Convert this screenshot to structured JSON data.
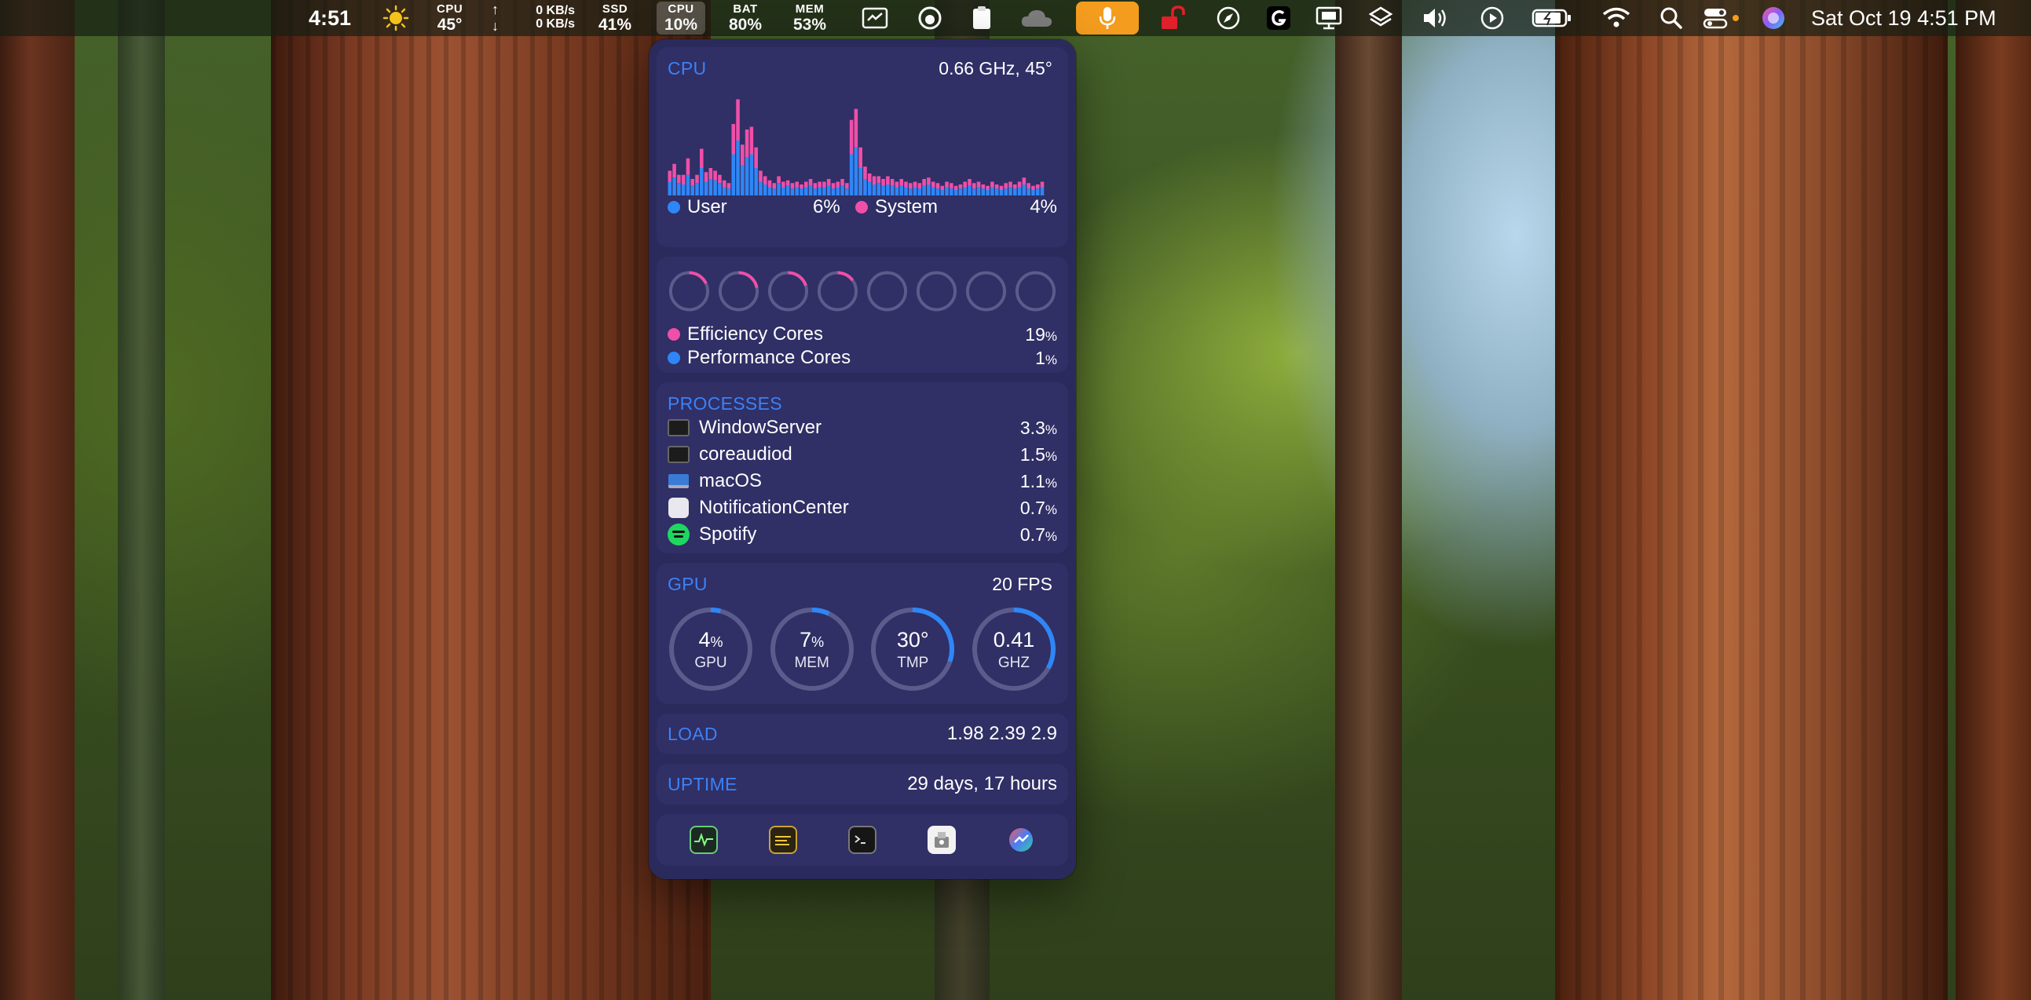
{
  "menubar": {
    "time": "4:51",
    "cpu": {
      "label": "CPU",
      "value": "45°"
    },
    "net": {
      "up": "0 KB/s",
      "down": "0 KB/s"
    },
    "ssd": {
      "label": "SSD",
      "value": "41%"
    },
    "cpu_usage": {
      "label": "CPU",
      "value": "10%"
    },
    "bat": {
      "label": "BAT",
      "value": "80%"
    },
    "mem": {
      "label": "MEM",
      "value": "53%"
    },
    "date": "Sat Oct 19  4:51 PM"
  },
  "cpu": {
    "title": "CPU",
    "freq_temp": "0.66 GHz, 45°",
    "user_label": "User",
    "user_pct": "6%",
    "system_label": "System",
    "system_pct": "4%",
    "history_user": [
      10,
      13,
      9,
      8,
      15,
      7,
      9,
      20,
      10,
      12,
      11,
      9,
      6,
      5,
      30,
      40,
      22,
      28,
      30,
      20,
      10,
      8,
      6,
      5,
      9,
      6,
      7,
      5,
      6,
      5,
      6,
      7,
      5,
      6,
      6,
      7,
      5,
      6,
      7,
      5,
      30,
      35,
      20,
      12,
      10,
      8,
      9,
      7,
      8,
      7,
      6,
      7,
      6,
      5,
      6,
      5,
      7,
      8,
      6,
      5,
      4,
      6,
      5,
      4,
      5,
      6,
      7,
      5,
      6,
      5,
      4,
      6,
      5,
      4,
      5,
      6,
      5,
      6,
      8,
      5,
      4,
      5,
      6
    ],
    "history_system": [
      8,
      10,
      6,
      7,
      12,
      5,
      6,
      14,
      7,
      8,
      7,
      6,
      5,
      4,
      22,
      30,
      15,
      20,
      20,
      15,
      8,
      6,
      5,
      4,
      5,
      4,
      4,
      4,
      4,
      3,
      4,
      5,
      4,
      4,
      4,
      5,
      4,
      4,
      5,
      4,
      25,
      28,
      15,
      9,
      6,
      6,
      5,
      5,
      6,
      5,
      4,
      5,
      4,
      4,
      4,
      4,
      5,
      5,
      4,
      4,
      3,
      4,
      4,
      3,
      3,
      4,
      5,
      4,
      4,
      3,
      3,
      4,
      3,
      3,
      4,
      4,
      3,
      4,
      5,
      4,
      3,
      3,
      4
    ],
    "history_max": 80
  },
  "cores": {
    "ring_usage": [
      0.18,
      0.22,
      0.2,
      0.15,
      0.0,
      0.0,
      0.0,
      0.0
    ],
    "ring_colors": [
      "pink",
      "pink",
      "pink",
      "pink",
      "blue",
      "blue",
      "blue",
      "blue"
    ],
    "efficiency_label": "Efficiency Cores",
    "efficiency_pct": "19",
    "performance_label": "Performance Cores",
    "performance_pct": "1",
    "pct_sign": "%"
  },
  "processes": {
    "title": "PROCESSES",
    "items": [
      {
        "name": "WindowServer",
        "pct": "3.3",
        "icon": "terminal-icon"
      },
      {
        "name": "coreaudiod",
        "pct": "1.5",
        "icon": "terminal-icon"
      },
      {
        "name": "macOS",
        "pct": "1.1",
        "icon": "laptop-icon"
      },
      {
        "name": "NotificationCenter",
        "pct": "0.7",
        "icon": "notification-icon"
      },
      {
        "name": "Spotify",
        "pct": "0.7",
        "icon": "spotify-icon"
      }
    ]
  },
  "gpu": {
    "title": "GPU",
    "fps": "20 FPS",
    "gauges": [
      {
        "value": "4",
        "unit": "%",
        "label": "GPU",
        "fill": 0.04
      },
      {
        "value": "7",
        "unit": "%",
        "label": "MEM",
        "fill": 0.07
      },
      {
        "value": "30°",
        "unit": "",
        "label": "TMP",
        "fill": 0.3
      },
      {
        "value": "0.41",
        "unit": "",
        "label": "GHZ",
        "fill": 0.33
      }
    ]
  },
  "load": {
    "title": "LOAD",
    "value": "1.98 2.39 2.9"
  },
  "uptime": {
    "title": "UPTIME",
    "value": "29 days, 17 hours"
  },
  "dock": [
    "activity-monitor-icon",
    "console-icon",
    "terminal-icon",
    "system-report-icon",
    "istat-menus-icon"
  ],
  "colors": {
    "blue": "#2f86f6",
    "pink": "#ef4fa8",
    "accent": "#3b82f6",
    "ring_track": "#5c5c8c"
  }
}
